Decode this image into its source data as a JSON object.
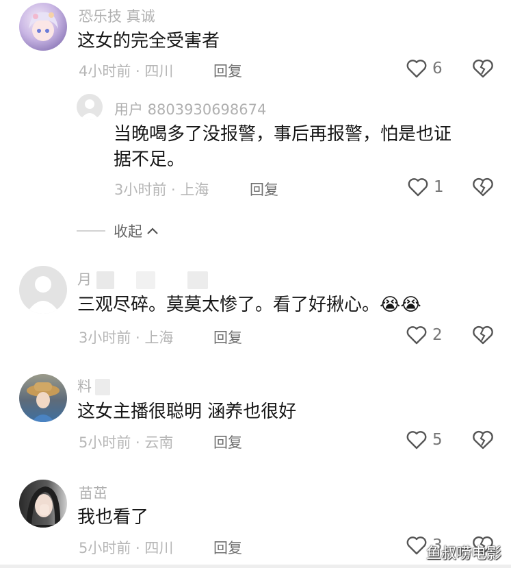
{
  "comments": [
    {
      "username": "恐乐技 真诚",
      "text": "这女的完全受害者",
      "time": "4小时前",
      "location": "四川",
      "reply_label": "回复",
      "likes": "6",
      "replies": [
        {
          "username": "用户 8803930698674",
          "text_line1": "当晚喝多了没报警，事后再报警，怕是也证",
          "text_line2": "据不足。",
          "time": "3小时前",
          "location": "上海",
          "reply_label": "回复",
          "likes": "1"
        }
      ],
      "collapse_label": "收起"
    },
    {
      "username": "月",
      "text": "三观尽碎。莫莫太惨了。看了好揪心。",
      "emoji": "😭😭",
      "time": "3小时前",
      "location": "上海",
      "reply_label": "回复",
      "likes": "2"
    },
    {
      "username": "料",
      "text": "这女主播很聪明 涵养也很好",
      "time": "5小时前",
      "location": "云南",
      "reply_label": "回复",
      "likes": "5"
    },
    {
      "username": "苗茁",
      "text": "我也看了",
      "time": "5小时前",
      "location": "四川",
      "reply_label": "回复",
      "likes": "3"
    }
  ],
  "separator": " · ",
  "watermark": "鱼叔唠电影",
  "colors": {
    "text": "#161616",
    "meta": "#b6b6b6",
    "icon": "#555555"
  }
}
